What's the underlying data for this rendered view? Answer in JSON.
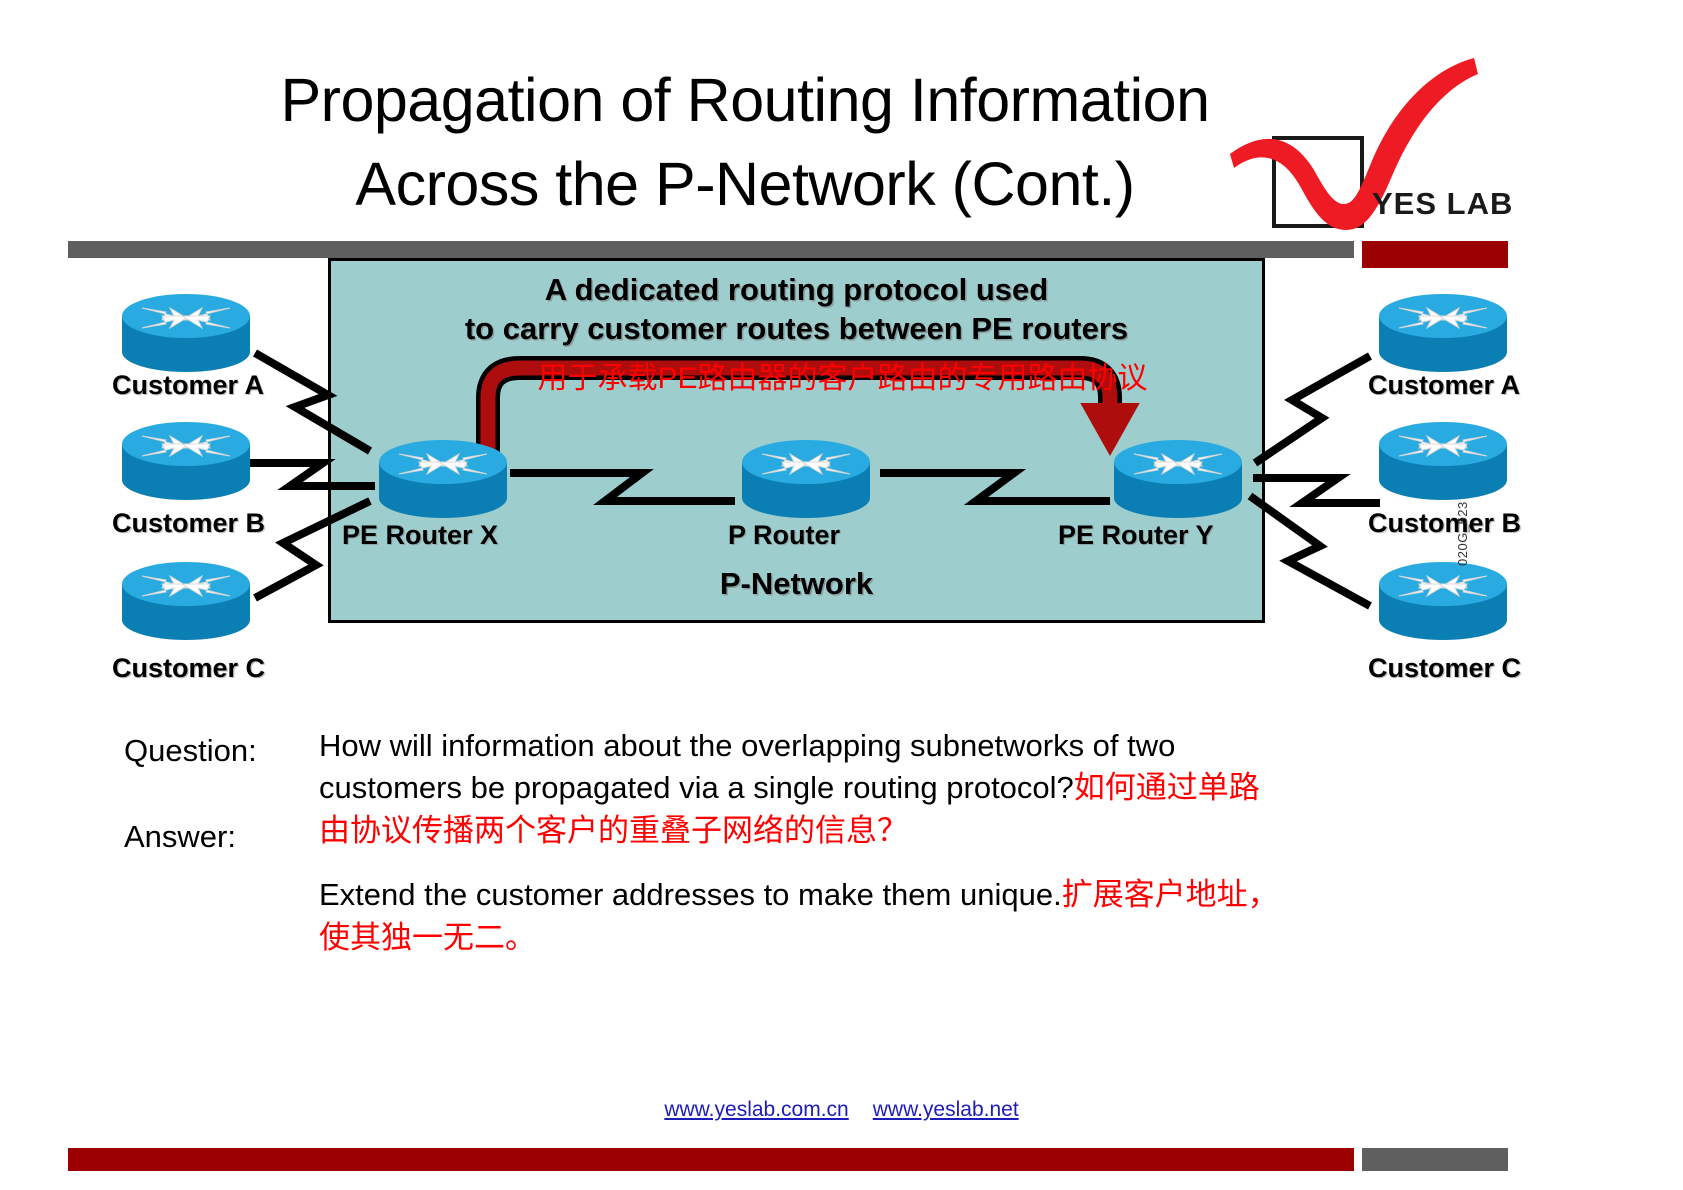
{
  "slide": {
    "title_line1": "Propagation of Routing Information",
    "title_line2": "Across the P-Network (Cont.)"
  },
  "logo": {
    "text": "YES LAB",
    "check_color": "#ee1b24",
    "box_color": "#1a1a1a"
  },
  "theme": {
    "grey_bar": "#5f5f5f",
    "red_bar": "#9c0000",
    "pnetwork_fill": "#9ecdcd",
    "router_top": "#29abe2",
    "router_body": "#0b7fb4",
    "arrow_red": "#ad0d0d",
    "annotation_red": "#ff0000",
    "link_blue": "#1c1cbb"
  },
  "diagram": {
    "callout_line1": "A dedicated routing protocol used",
    "callout_line2": "to carry customer routes between PE routers",
    "callout_cn": "用于承载PE路由器的客户路由的专用路由协议",
    "pnetwork_label": "P-Network",
    "core_nodes": [
      {
        "id": "pe-router-x",
        "label": "PE Router X"
      },
      {
        "id": "p-router",
        "label": "P Router"
      },
      {
        "id": "pe-router-y",
        "label": "PE Router Y"
      }
    ],
    "left_customers": [
      {
        "id": "customer-a-left",
        "label": "Customer A"
      },
      {
        "id": "customer-b-left",
        "label": "Customer B"
      },
      {
        "id": "customer-c-left",
        "label": "Customer C"
      }
    ],
    "right_customers": [
      {
        "id": "customer-a-right",
        "label": "Customer A"
      },
      {
        "id": "customer-b-right",
        "label": "Customer B"
      },
      {
        "id": "customer-c-right",
        "label": "Customer C"
      }
    ],
    "figure_code": "020G_523"
  },
  "qa": {
    "question_tag": "Question:",
    "answer_tag": "Answer:",
    "question_en": "How will information about the overlapping subnetworks of two customers be propagated via a single routing protocol?",
    "question_cn": "如何通过单路由协议传播两个客户的重叠子网络的信息？",
    "answer_en": "Extend the customer addresses to make them unique.",
    "answer_cn": "扩展客户地址，使其独一无二。"
  },
  "footer": {
    "link1": "www.yeslab.com.cn",
    "link2": "www.yeslab.net"
  }
}
